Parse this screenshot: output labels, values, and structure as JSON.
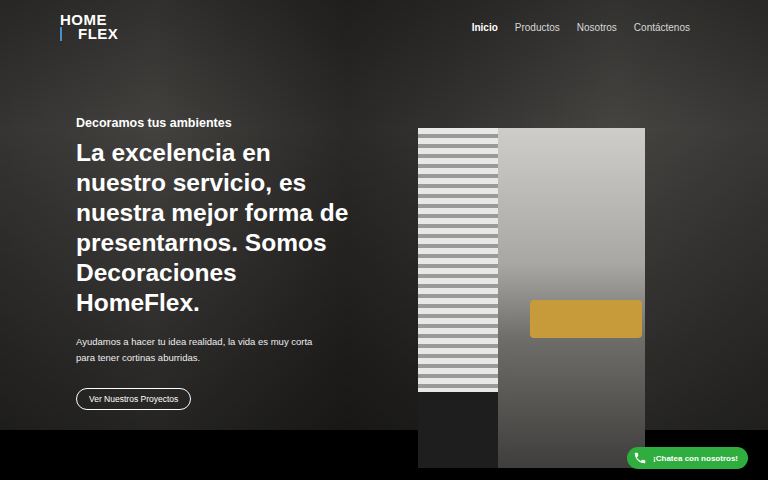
{
  "logo": {
    "line1": "HOME",
    "line2": "FLEX"
  },
  "nav": [
    {
      "label": "Inicio",
      "selected": true
    },
    {
      "label": "Productos",
      "selected": false
    },
    {
      "label": "Nosotros",
      "selected": false
    },
    {
      "label": "Contáctenos",
      "selected": false
    }
  ],
  "hero": {
    "eyebrow": "Decoramos tus ambientes",
    "headline": "La excelencia en nuestro servicio, es nuestra mejor forma de presentarnos. Somos Decoraciones HomeFlex.",
    "text": "Ayudamos a hacer tu idea realidad, la vida es muy corta para tener cortinas aburridas.",
    "button": "Ver Nuestros Proyectos"
  },
  "chat": {
    "label": "¡Chatea con nosotros!"
  }
}
